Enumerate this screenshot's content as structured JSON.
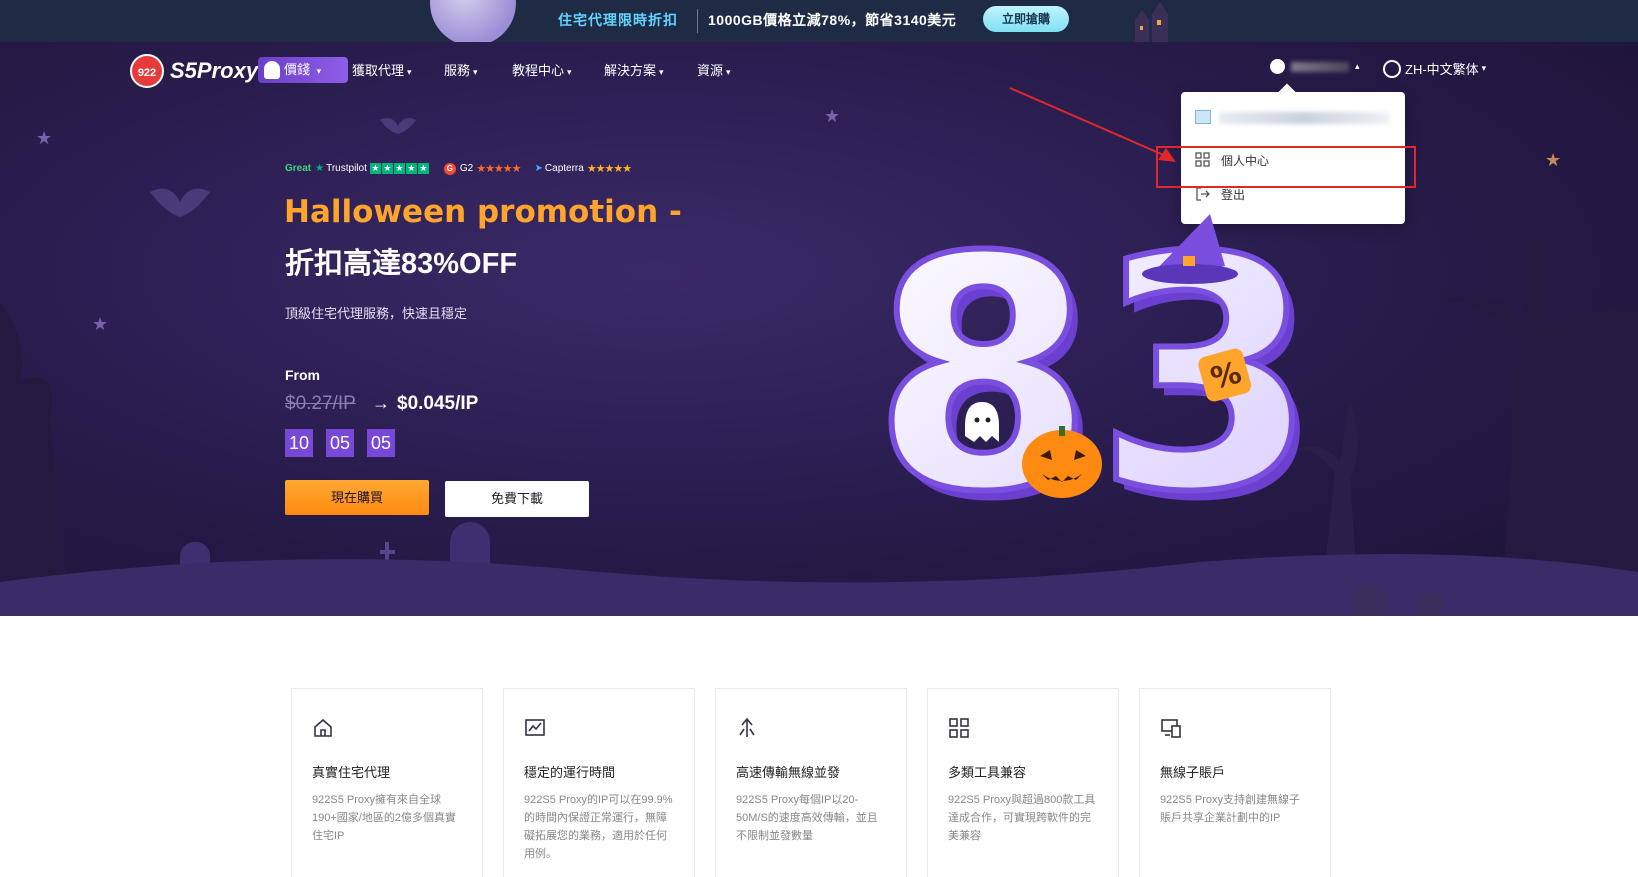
{
  "promo": {
    "title": "住宅代理限時折扣",
    "detail": "1000GB價格立減78%，節省3140美元",
    "button": "立即搶購"
  },
  "nav": {
    "logo_badge": "922",
    "logo_text": "S5Proxy",
    "price_tag": "價錢",
    "items": [
      {
        "label": "獲取代理"
      },
      {
        "label": "服務"
      },
      {
        "label": "教程中心"
      },
      {
        "label": "解決方案"
      },
      {
        "label": "資源"
      }
    ],
    "language": "ZH-中文繁体"
  },
  "dropdown": {
    "items": [
      {
        "label": "個人中心",
        "icon": "grid-icon"
      },
      {
        "label": "登出",
        "icon": "logout-icon"
      }
    ]
  },
  "ratings": {
    "trustpilot_great": "Great",
    "trustpilot": "Trustpilot",
    "g2": "G2",
    "capterra": "Capterra"
  },
  "hero": {
    "title_line1": "Halloween promotion -",
    "title_line2": "折扣高達83%OFF",
    "subtitle": "頂級住宅代理服務，快速且穩定",
    "from_label": "From",
    "old_price": "$0.27/IP",
    "new_price": "$0.045/IP",
    "timer": [
      "10",
      "05",
      "05"
    ],
    "buy_button": "現在購買",
    "download_button": "免費下載",
    "big_number": "83",
    "percent": "%"
  },
  "features": [
    {
      "title": "真實住宅代理",
      "desc": "922S5 Proxy擁有來自全球190+國家/地區的2億多個真實住宅IP",
      "icon": "home-icon"
    },
    {
      "title": "穩定的運行時間",
      "desc": "922S5 Proxy的IP可以在99.9%的時間內保證正常運行，無障礙拓展您的業務，適用於任何用例。",
      "icon": "chart-icon"
    },
    {
      "title": "高速傳輸無線並發",
      "desc": "922S5 Proxy每個IP以20-50M/S的速度高效傳輸，並且不限制並發數量",
      "icon": "speed-icon"
    },
    {
      "title": "多類工具兼容",
      "desc": "922S5 Proxy與超過800款工具達成合作，可實現跨軟件的完美兼容",
      "icon": "grid-icon"
    },
    {
      "title": "無線子賬戶",
      "desc": "922S5 Proxy支持創建無線子賬戶共享企業計劃中的IP",
      "icon": "devices-icon"
    }
  ],
  "colors": {
    "hero_bg": "#2a1d4f",
    "accent_orange": "#ff8a12",
    "accent_purple": "#7848d8",
    "promo_cyan": "#5fd4ff",
    "highlight_red": "#e0282b"
  }
}
